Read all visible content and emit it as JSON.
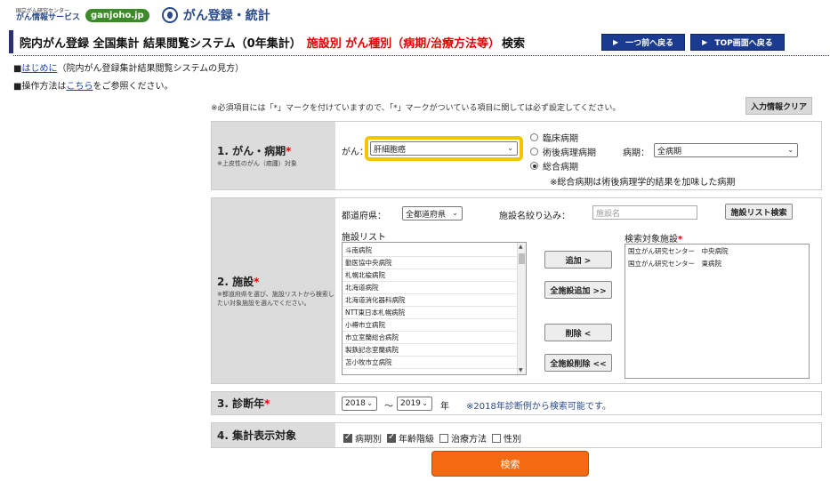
{
  "header": {
    "logo_line1": "国立がん研究センター",
    "logo_line2": "がん情報サービス",
    "logo_badge": "ganjoho.jp",
    "site_title": "がん登録・統計",
    "title_main": "院内がん登録 全国集計 結果閲覧システム（0年集計）",
    "title_red": "施設別 がん種別（病期/治療方法等）",
    "title_end": "検索",
    "nav_back": "一つ前へ戻る",
    "nav_top": "TOP画面へ戻る"
  },
  "info": {
    "line1_prefix": "■",
    "line1_link": "はじめに",
    "line1_text": "（院内がん登録集計結果閲覧システムの見方）",
    "line2_prefix": "■操作方法は",
    "line2_link": "こちら",
    "line2_text": "をご参照ください。"
  },
  "note": "※必須項目には「*」マークを付けていますので、「*」マークがついている項目に関しては必ず設定してください。",
  "clear_button": "入力情報クリア",
  "row1": {
    "label": "1. がん・病期",
    "star": "*",
    "sub": "※上皮性のがん（癌腫）対象",
    "gan_label": "がん：",
    "gan_value": "肝細胞癌",
    "radio_clinical": "臨床病期",
    "radio_pathological": "術後病理病期",
    "radio_total": "総合病期",
    "stage_label": "病期：",
    "stage_value": "全病期",
    "footnote": "※総合病期は術後病理学的結果を加味した病期"
  },
  "row2": {
    "label": "2. 施設",
    "star": "*",
    "sub": "※都道府県を選び、施設リストから検索したい対象施設を選んでください。",
    "pref_label": "都道府県：",
    "pref_value": "全都道府県",
    "filter_label": "施設名絞り込み：",
    "filter_placeholder": "施設名",
    "list_search_button": "施設リスト検索",
    "list_title": "施設リスト",
    "list_items": [
      "斗南病院",
      "勤医協中央病院",
      "札幌北楡病院",
      "北海道病院",
      "北海道消化器科病院",
      "NTT東日本札幌病院",
      "小樽市立病院",
      "市立室蘭総合病院",
      "製鉄記念室蘭病院",
      "苫小牧市立病院"
    ],
    "add_button": "追加 >",
    "add_all_button": "全施設追加 >>",
    "remove_button": "削除 <",
    "remove_all_button": "全施設削除 <<",
    "target_title": "検索対象施設",
    "target_star": "*",
    "target_items": [
      "国立がん研究センター　中央病院",
      "国立がん研究センター　東病院"
    ]
  },
  "row3": {
    "label": "3. 診断年",
    "star": "*",
    "from_year": "2018",
    "tilde": "～",
    "to_year": "2019",
    "unit": "年",
    "note": "※2018年診断例から検索可能です。"
  },
  "row4": {
    "label": "4. 集計表示対象",
    "options": [
      {
        "label": "病期別",
        "checked": true
      },
      {
        "label": "年齢階級",
        "checked": true
      },
      {
        "label": "治療方法",
        "checked": false
      },
      {
        "label": "性別",
        "checked": false
      }
    ]
  },
  "search_button": "検索",
  "colors": {
    "title_bar": "#2a2f73",
    "red": "#e00000",
    "nav_button": "#1a3b8f",
    "search_button": "#f26a12",
    "highlight": "#f5c400"
  }
}
